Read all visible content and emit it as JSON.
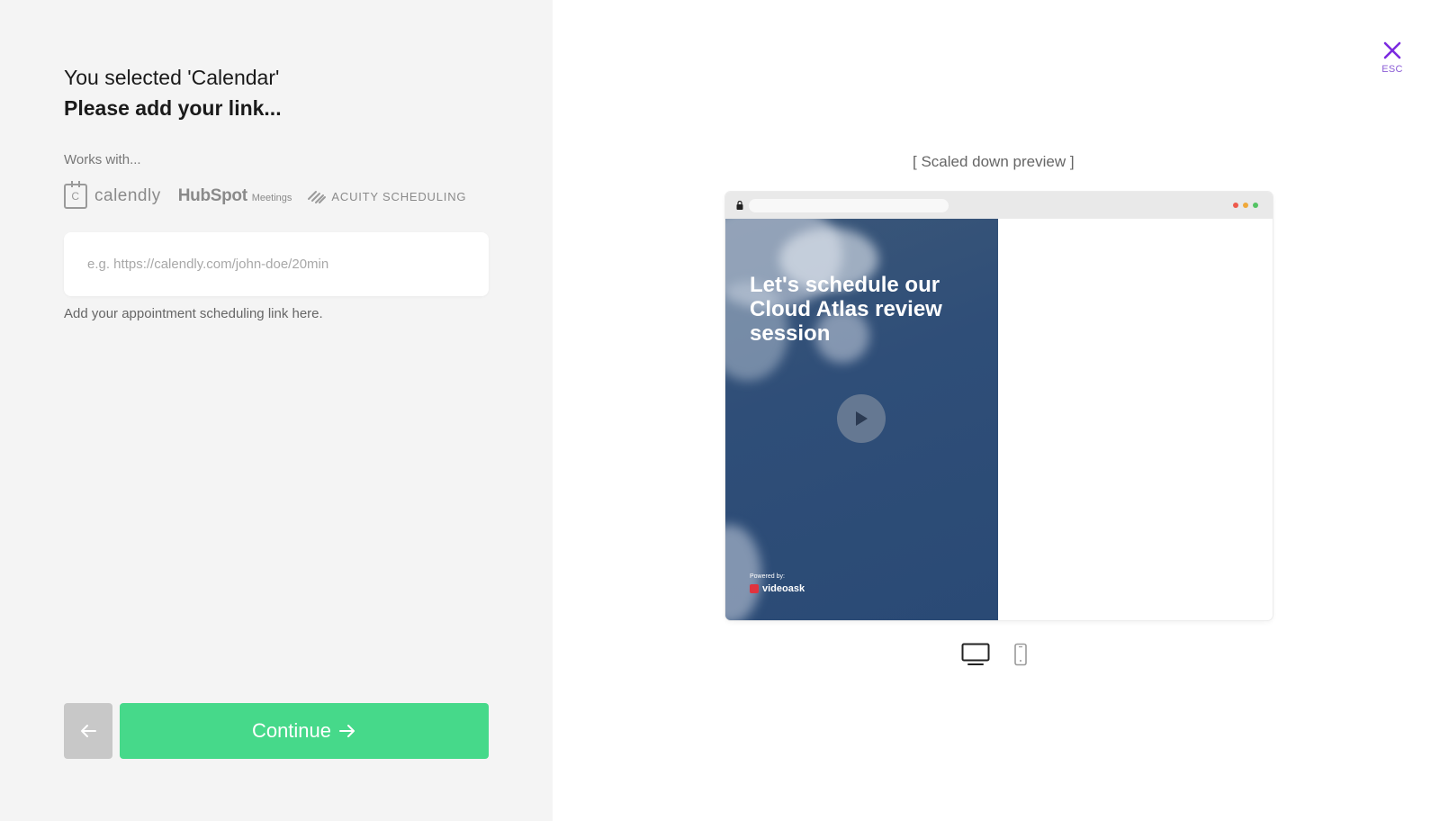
{
  "left": {
    "heading_selected": "You selected 'Calendar'",
    "heading_prompt": "Please add your link...",
    "works_with": "Works with...",
    "logos": {
      "calendly": "calendly",
      "hubspot": "HubSpot",
      "hubspot_sub": "Meetings",
      "acuity": "ACUITY SCHEDULING"
    },
    "link_input": {
      "value": "",
      "placeholder": "e.g. https://calendly.com/john-doe/20min"
    },
    "helper": "Add your appointment scheduling link here.",
    "continue_label": "Continue"
  },
  "close": {
    "esc_label": "ESC"
  },
  "preview": {
    "label": "[ Scaled down preview ]",
    "video_title": "Let's schedule our Cloud Atlas review session",
    "powered_by": "Powered by:",
    "brand": "videoask",
    "device_modes": [
      "desktop",
      "mobile"
    ],
    "selected_device": "desktop"
  },
  "colors": {
    "accent_green": "#46d98a",
    "accent_purple": "#7b2ae0",
    "left_bg": "#f4f4f4"
  }
}
